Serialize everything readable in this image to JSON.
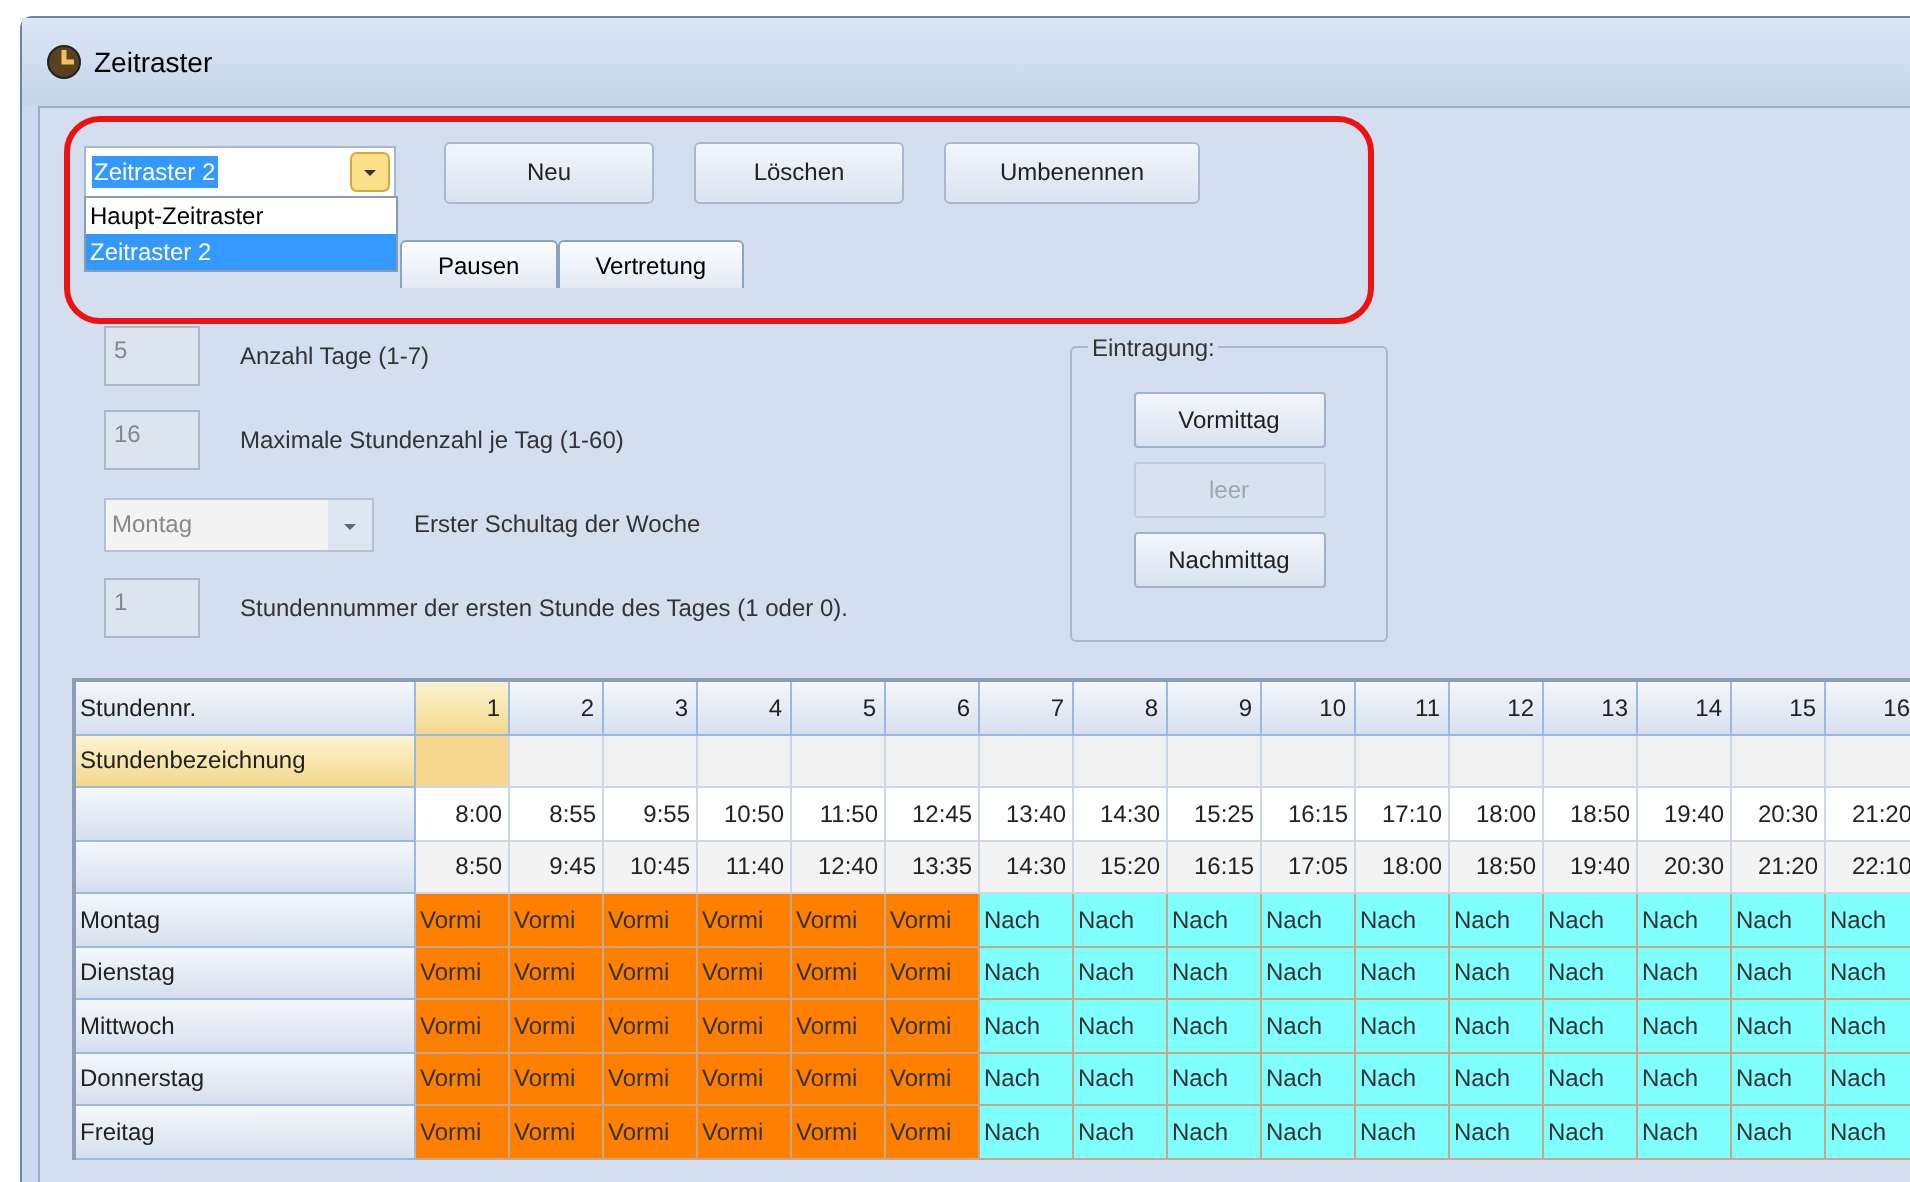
{
  "window": {
    "title": "Zeitraster"
  },
  "toolbar": {
    "combo": {
      "value": "Zeitraster 2",
      "options": [
        {
          "label": "Haupt-Zeitraster",
          "selected": false
        },
        {
          "label": "Zeitraster 2",
          "selected": true
        }
      ]
    },
    "buttons": [
      "Neu",
      "Löschen",
      "Umbenennen"
    ]
  },
  "tabs": [
    {
      "label": "Pausen",
      "selected": false
    },
    {
      "label": "Vertretung",
      "selected": false
    }
  ],
  "settings": [
    {
      "kind": "field",
      "value": "5",
      "label": "Anzahl Tage (1-7)"
    },
    {
      "kind": "field",
      "value": "16",
      "label": "Maximale Stundenzahl je Tag (1-60)"
    },
    {
      "kind": "select",
      "value": "Montag",
      "label": "Erster Schultag der Woche"
    },
    {
      "kind": "field",
      "value": "1",
      "label": "Stundennummer der ersten Stunde des Tages (1 oder 0)."
    }
  ],
  "eintragung": {
    "title": "Eintragung:",
    "buttons": [
      {
        "label": "Vormittag",
        "disabled": false
      },
      {
        "label": "leer",
        "disabled": true
      },
      {
        "label": "Nachmittag",
        "disabled": false
      }
    ]
  },
  "grid": {
    "columns": [
      {
        "label": "1",
        "selected": true
      },
      {
        "label": "2",
        "selected": false
      },
      {
        "label": "3",
        "selected": false
      },
      {
        "label": "4",
        "selected": false
      },
      {
        "label": "5",
        "selected": false
      },
      {
        "label": "6",
        "selected": false
      },
      {
        "label": "7",
        "selected": false
      },
      {
        "label": "8",
        "selected": false
      },
      {
        "label": "9",
        "selected": false
      },
      {
        "label": "10",
        "selected": false
      },
      {
        "label": "11",
        "selected": false
      },
      {
        "label": "12",
        "selected": false
      },
      {
        "label": "13",
        "selected": false
      },
      {
        "label": "14",
        "selected": false
      },
      {
        "label": "15",
        "selected": false
      },
      {
        "label": "16",
        "selected": false
      }
    ],
    "header_label": "Stundennr.",
    "rows": [
      {
        "label": "Stundenbezeichnung",
        "selected": true,
        "kind": "names",
        "cells": []
      },
      {
        "kind": "times",
        "selected": false,
        "cells": [
          "8:00",
          "8:55",
          "9:55",
          "10:50",
          "11:50",
          "12:45",
          "13:40",
          "14:30",
          "15:25",
          "16:15",
          "17:10",
          "18:00",
          "18:50",
          "19:40",
          "20:30",
          "21:20"
        ]
      },
      {
        "kind": "times",
        "selected": false,
        "cells": [
          "8:50",
          "9:45",
          "10:45",
          "11:40",
          "12:40",
          "13:35",
          "14:30",
          "15:20",
          "16:15",
          "17:05",
          "18:00",
          "18:50",
          "19:40",
          "20:30",
          "21:20",
          "22:10"
        ]
      },
      {
        "label": "Montag",
        "kind": "day",
        "selected": false,
        "cells": [
          {
            "text": "Vormi",
            "kind": "vormittag"
          },
          {
            "text": "Vormi",
            "kind": "vormittag"
          },
          {
            "text": "Vormi",
            "kind": "vormittag"
          },
          {
            "text": "Vormi",
            "kind": "vormittag"
          },
          {
            "text": "Vormi",
            "kind": "vormittag"
          },
          {
            "text": "Vormi",
            "kind": "vormittag"
          },
          {
            "text": "Nach",
            "kind": "nachmittag"
          },
          {
            "text": "Nach",
            "kind": "nachmittag"
          },
          {
            "text": "Nach",
            "kind": "nachmittag"
          },
          {
            "text": "Nach",
            "kind": "nachmittag"
          },
          {
            "text": "Nach",
            "kind": "nachmittag"
          },
          {
            "text": "Nach",
            "kind": "nachmittag"
          },
          {
            "text": "Nach",
            "kind": "nachmittag"
          },
          {
            "text": "Nach",
            "kind": "nachmittag"
          },
          {
            "text": "Nach",
            "kind": "nachmittag"
          },
          {
            "text": "Nach",
            "kind": "nachmittag"
          }
        ]
      },
      {
        "label": "Dienstag",
        "kind": "day",
        "selected": false,
        "cells": [
          {
            "text": "Vormi",
            "kind": "vormittag"
          },
          {
            "text": "Vormi",
            "kind": "vormittag"
          },
          {
            "text": "Vormi",
            "kind": "vormittag"
          },
          {
            "text": "Vormi",
            "kind": "vormittag"
          },
          {
            "text": "Vormi",
            "kind": "vormittag"
          },
          {
            "text": "Vormi",
            "kind": "vormittag"
          },
          {
            "text": "Nach",
            "kind": "nachmittag"
          },
          {
            "text": "Nach",
            "kind": "nachmittag"
          },
          {
            "text": "Nach",
            "kind": "nachmittag"
          },
          {
            "text": "Nach",
            "kind": "nachmittag"
          },
          {
            "text": "Nach",
            "kind": "nachmittag"
          },
          {
            "text": "Nach",
            "kind": "nachmittag"
          },
          {
            "text": "Nach",
            "kind": "nachmittag"
          },
          {
            "text": "Nach",
            "kind": "nachmittag"
          },
          {
            "text": "Nach",
            "kind": "nachmittag"
          },
          {
            "text": "Nach",
            "kind": "nachmittag"
          }
        ]
      },
      {
        "label": "Mittwoch",
        "kind": "day",
        "selected": false,
        "cells": [
          {
            "text": "Vormi",
            "kind": "vormittag"
          },
          {
            "text": "Vormi",
            "kind": "vormittag"
          },
          {
            "text": "Vormi",
            "kind": "vormittag"
          },
          {
            "text": "Vormi",
            "kind": "vormittag"
          },
          {
            "text": "Vormi",
            "kind": "vormittag"
          },
          {
            "text": "Vormi",
            "kind": "vormittag"
          },
          {
            "text": "Nach",
            "kind": "nachmittag"
          },
          {
            "text": "Nach",
            "kind": "nachmittag"
          },
          {
            "text": "Nach",
            "kind": "nachmittag"
          },
          {
            "text": "Nach",
            "kind": "nachmittag"
          },
          {
            "text": "Nach",
            "kind": "nachmittag"
          },
          {
            "text": "Nach",
            "kind": "nachmittag"
          },
          {
            "text": "Nach",
            "kind": "nachmittag"
          },
          {
            "text": "Nach",
            "kind": "nachmittag"
          },
          {
            "text": "Nach",
            "kind": "nachmittag"
          },
          {
            "text": "Nach",
            "kind": "nachmittag"
          }
        ]
      },
      {
        "label": "Donnerstag",
        "kind": "day",
        "selected": false,
        "cells": [
          {
            "text": "Vormi",
            "kind": "vormittag"
          },
          {
            "text": "Vormi",
            "kind": "vormittag"
          },
          {
            "text": "Vormi",
            "kind": "vormittag"
          },
          {
            "text": "Vormi",
            "kind": "vormittag"
          },
          {
            "text": "Vormi",
            "kind": "vormittag"
          },
          {
            "text": "Vormi",
            "kind": "vormittag"
          },
          {
            "text": "Nach",
            "kind": "nachmittag"
          },
          {
            "text": "Nach",
            "kind": "nachmittag"
          },
          {
            "text": "Nach",
            "kind": "nachmittag"
          },
          {
            "text": "Nach",
            "kind": "nachmittag"
          },
          {
            "text": "Nach",
            "kind": "nachmittag"
          },
          {
            "text": "Nach",
            "kind": "nachmittag"
          },
          {
            "text": "Nach",
            "kind": "nachmittag"
          },
          {
            "text": "Nach",
            "kind": "nachmittag"
          },
          {
            "text": "Nach",
            "kind": "nachmittag"
          },
          {
            "text": "Nach",
            "kind": "nachmittag"
          }
        ]
      },
      {
        "label": "Freitag",
        "kind": "day",
        "selected": false,
        "cells": [
          {
            "text": "Vormi",
            "kind": "vormittag"
          },
          {
            "text": "Vormi",
            "kind": "vormittag"
          },
          {
            "text": "Vormi",
            "kind": "vormittag"
          },
          {
            "text": "Vormi",
            "kind": "vormittag"
          },
          {
            "text": "Vormi",
            "kind": "vormittag"
          },
          {
            "text": "Vormi",
            "kind": "vormittag"
          },
          {
            "text": "Nach",
            "kind": "nachmittag"
          },
          {
            "text": "Nach",
            "kind": "nachmittag"
          },
          {
            "text": "Nach",
            "kind": "nachmittag"
          },
          {
            "text": "Nach",
            "kind": "nachmittag"
          },
          {
            "text": "Nach",
            "kind": "nachmittag"
          },
          {
            "text": "Nach",
            "kind": "nachmittag"
          },
          {
            "text": "Nach",
            "kind": "nachmittag"
          },
          {
            "text": "Nach",
            "kind": "nachmittag"
          },
          {
            "text": "Nach",
            "kind": "nachmittag"
          },
          {
            "text": "Nach",
            "kind": "nachmittag"
          }
        ]
      }
    ]
  }
}
